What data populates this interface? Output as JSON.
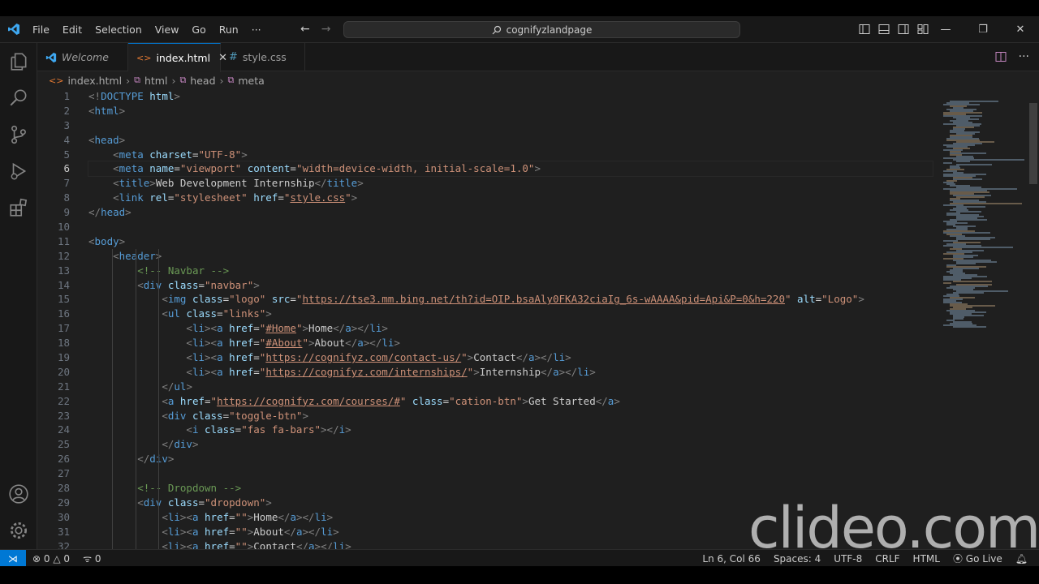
{
  "titlebar": {
    "menu": [
      "File",
      "Edit",
      "Selection",
      "View",
      "Go",
      "Run",
      "···"
    ],
    "search_text": "cognifyzlandpage",
    "window_controls": [
      "minimize-icon",
      "restore-icon",
      "close-icon"
    ]
  },
  "tabs": [
    {
      "label": "Welcome",
      "icon": "vscode-icon"
    },
    {
      "label": "index.html",
      "icon": "html-icon",
      "active": true
    },
    {
      "label": "style.css",
      "icon": "css-hash-icon"
    }
  ],
  "breadcrumb": [
    "index.html",
    "html",
    "head",
    "meta"
  ],
  "editor": {
    "line_numbers": [
      "1",
      "2",
      "3",
      "4",
      "5",
      "6",
      "7",
      "8",
      "9",
      "10",
      "11",
      "12",
      "13",
      "14",
      "15",
      "16",
      "17",
      "18",
      "19",
      "20",
      "21",
      "22",
      "23",
      "24",
      "25",
      "26",
      "27",
      "28",
      "29",
      "30",
      "31",
      "32"
    ],
    "active_line": "6",
    "lines": [
      [
        [
          "p",
          "<!"
        ],
        [
          "t",
          "DOCTYPE"
        ],
        [
          "x",
          " "
        ],
        [
          "a",
          "html"
        ],
        [
          "p",
          ">"
        ]
      ],
      [
        [
          "p",
          "<"
        ],
        [
          "t",
          "html"
        ],
        [
          "p",
          ">"
        ]
      ],
      [],
      [
        [
          "p",
          "<"
        ],
        [
          "t",
          "head"
        ],
        [
          "p",
          ">"
        ]
      ],
      [
        [
          "x",
          "    "
        ],
        [
          "p",
          "<"
        ],
        [
          "t",
          "meta"
        ],
        [
          "x",
          " "
        ],
        [
          "a",
          "charset"
        ],
        [
          "x",
          "="
        ],
        [
          "s",
          "\"UTF-8\""
        ],
        [
          "p",
          ">"
        ]
      ],
      [
        [
          "x",
          "    "
        ],
        [
          "p",
          "<"
        ],
        [
          "t",
          "meta"
        ],
        [
          "x",
          " "
        ],
        [
          "a",
          "name"
        ],
        [
          "x",
          "="
        ],
        [
          "s",
          "\"viewport\""
        ],
        [
          "x",
          " "
        ],
        [
          "a",
          "content"
        ],
        [
          "x",
          "="
        ],
        [
          "s",
          "\"width=device-width, initial-scale=1.0\""
        ],
        [
          "p",
          ">"
        ]
      ],
      [
        [
          "x",
          "    "
        ],
        [
          "p",
          "<"
        ],
        [
          "t",
          "title"
        ],
        [
          "p",
          ">"
        ],
        [
          "x",
          "Web Development Internship"
        ],
        [
          "p",
          "</"
        ],
        [
          "t",
          "title"
        ],
        [
          "p",
          ">"
        ]
      ],
      [
        [
          "x",
          "    "
        ],
        [
          "p",
          "<"
        ],
        [
          "t",
          "link"
        ],
        [
          "x",
          " "
        ],
        [
          "a",
          "rel"
        ],
        [
          "x",
          "="
        ],
        [
          "s",
          "\"stylesheet\""
        ],
        [
          "x",
          " "
        ],
        [
          "a",
          "href"
        ],
        [
          "x",
          "="
        ],
        [
          "s",
          "\""
        ],
        [
          "u",
          "style.css"
        ],
        [
          "s",
          "\""
        ],
        [
          "p",
          ">"
        ]
      ],
      [
        [
          "p",
          "</"
        ],
        [
          "t",
          "head"
        ],
        [
          "p",
          ">"
        ]
      ],
      [],
      [
        [
          "p",
          "<"
        ],
        [
          "t",
          "body"
        ],
        [
          "p",
          ">"
        ]
      ],
      [
        [
          "x",
          "    "
        ],
        [
          "p",
          "<"
        ],
        [
          "t",
          "header"
        ],
        [
          "p",
          ">"
        ]
      ],
      [
        [
          "x",
          "        "
        ],
        [
          "c",
          "<!-- Navbar -->"
        ]
      ],
      [
        [
          "x",
          "        "
        ],
        [
          "p",
          "<"
        ],
        [
          "t",
          "div"
        ],
        [
          "x",
          " "
        ],
        [
          "a",
          "class"
        ],
        [
          "x",
          "="
        ],
        [
          "s",
          "\"navbar\""
        ],
        [
          "p",
          ">"
        ]
      ],
      [
        [
          "x",
          "            "
        ],
        [
          "p",
          "<"
        ],
        [
          "t",
          "img"
        ],
        [
          "x",
          " "
        ],
        [
          "a",
          "class"
        ],
        [
          "x",
          "="
        ],
        [
          "s",
          "\"logo\""
        ],
        [
          "x",
          " "
        ],
        [
          "a",
          "src"
        ],
        [
          "x",
          "="
        ],
        [
          "s",
          "\""
        ],
        [
          "u",
          "https://tse3.mm.bing.net/th?id=OIP.bsaAly0FKA32ciaIg_6s-wAAAA&pid=Api&P=0&h=220"
        ],
        [
          "s",
          "\""
        ],
        [
          "x",
          " "
        ],
        [
          "a",
          "alt"
        ],
        [
          "x",
          "="
        ],
        [
          "s",
          "\"Logo\""
        ],
        [
          "p",
          ">"
        ]
      ],
      [
        [
          "x",
          "            "
        ],
        [
          "p",
          "<"
        ],
        [
          "t",
          "ul"
        ],
        [
          "x",
          " "
        ],
        [
          "a",
          "class"
        ],
        [
          "x",
          "="
        ],
        [
          "s",
          "\"links\""
        ],
        [
          "p",
          ">"
        ]
      ],
      [
        [
          "x",
          "                "
        ],
        [
          "p",
          "<"
        ],
        [
          "t",
          "li"
        ],
        [
          "p",
          "><"
        ],
        [
          "t",
          "a"
        ],
        [
          "x",
          " "
        ],
        [
          "a",
          "href"
        ],
        [
          "x",
          "="
        ],
        [
          "s",
          "\""
        ],
        [
          "u",
          "#Home"
        ],
        [
          "s",
          "\""
        ],
        [
          "p",
          ">"
        ],
        [
          "x",
          "Home"
        ],
        [
          "p",
          "</"
        ],
        [
          "t",
          "a"
        ],
        [
          "p",
          "></"
        ],
        [
          "t",
          "li"
        ],
        [
          "p",
          ">"
        ]
      ],
      [
        [
          "x",
          "                "
        ],
        [
          "p",
          "<"
        ],
        [
          "t",
          "li"
        ],
        [
          "p",
          "><"
        ],
        [
          "t",
          "a"
        ],
        [
          "x",
          " "
        ],
        [
          "a",
          "href"
        ],
        [
          "x",
          "="
        ],
        [
          "s",
          "\""
        ],
        [
          "u",
          "#About"
        ],
        [
          "s",
          "\""
        ],
        [
          "p",
          ">"
        ],
        [
          "x",
          "About"
        ],
        [
          "p",
          "</"
        ],
        [
          "t",
          "a"
        ],
        [
          "p",
          "></"
        ],
        [
          "t",
          "li"
        ],
        [
          "p",
          ">"
        ]
      ],
      [
        [
          "x",
          "                "
        ],
        [
          "p",
          "<"
        ],
        [
          "t",
          "li"
        ],
        [
          "p",
          "><"
        ],
        [
          "t",
          "a"
        ],
        [
          "x",
          " "
        ],
        [
          "a",
          "href"
        ],
        [
          "x",
          "="
        ],
        [
          "s",
          "\""
        ],
        [
          "u",
          "https://cognifyz.com/contact-us/"
        ],
        [
          "s",
          "\""
        ],
        [
          "p",
          ">"
        ],
        [
          "x",
          "Contact"
        ],
        [
          "p",
          "</"
        ],
        [
          "t",
          "a"
        ],
        [
          "p",
          "></"
        ],
        [
          "t",
          "li"
        ],
        [
          "p",
          ">"
        ]
      ],
      [
        [
          "x",
          "                "
        ],
        [
          "p",
          "<"
        ],
        [
          "t",
          "li"
        ],
        [
          "p",
          "><"
        ],
        [
          "t",
          "a"
        ],
        [
          "x",
          " "
        ],
        [
          "a",
          "href"
        ],
        [
          "x",
          "="
        ],
        [
          "s",
          "\""
        ],
        [
          "u",
          "https://cognifyz.com/internships/"
        ],
        [
          "s",
          "\""
        ],
        [
          "p",
          ">"
        ],
        [
          "x",
          "Internship"
        ],
        [
          "p",
          "</"
        ],
        [
          "t",
          "a"
        ],
        [
          "p",
          "></"
        ],
        [
          "t",
          "li"
        ],
        [
          "p",
          ">"
        ]
      ],
      [
        [
          "x",
          "            "
        ],
        [
          "p",
          "</"
        ],
        [
          "t",
          "ul"
        ],
        [
          "p",
          ">"
        ]
      ],
      [
        [
          "x",
          "            "
        ],
        [
          "p",
          "<"
        ],
        [
          "t",
          "a"
        ],
        [
          "x",
          " "
        ],
        [
          "a",
          "href"
        ],
        [
          "x",
          "="
        ],
        [
          "s",
          "\""
        ],
        [
          "u",
          "https://cognifyz.com/courses/#"
        ],
        [
          "s",
          "\""
        ],
        [
          "x",
          " "
        ],
        [
          "a",
          "class"
        ],
        [
          "x",
          "="
        ],
        [
          "s",
          "\"cation-btn\""
        ],
        [
          "p",
          ">"
        ],
        [
          "x",
          "Get Started"
        ],
        [
          "p",
          "</"
        ],
        [
          "t",
          "a"
        ],
        [
          "p",
          ">"
        ]
      ],
      [
        [
          "x",
          "            "
        ],
        [
          "p",
          "<"
        ],
        [
          "t",
          "div"
        ],
        [
          "x",
          " "
        ],
        [
          "a",
          "class"
        ],
        [
          "x",
          "="
        ],
        [
          "s",
          "\"toggle-btn\""
        ],
        [
          "p",
          ">"
        ]
      ],
      [
        [
          "x",
          "                "
        ],
        [
          "p",
          "<"
        ],
        [
          "t",
          "i"
        ],
        [
          "x",
          " "
        ],
        [
          "a",
          "class"
        ],
        [
          "x",
          "="
        ],
        [
          "s",
          "\"fas fa-bars\""
        ],
        [
          "p",
          "></"
        ],
        [
          "t",
          "i"
        ],
        [
          "p",
          ">"
        ]
      ],
      [
        [
          "x",
          "            "
        ],
        [
          "p",
          "</"
        ],
        [
          "t",
          "div"
        ],
        [
          "p",
          ">"
        ]
      ],
      [
        [
          "x",
          "        "
        ],
        [
          "p",
          "</"
        ],
        [
          "t",
          "div"
        ],
        [
          "p",
          ">"
        ]
      ],
      [],
      [
        [
          "x",
          "        "
        ],
        [
          "c",
          "<!-- Dropdown -->"
        ]
      ],
      [
        [
          "x",
          "        "
        ],
        [
          "p",
          "<"
        ],
        [
          "t",
          "div"
        ],
        [
          "x",
          " "
        ],
        [
          "a",
          "class"
        ],
        [
          "x",
          "="
        ],
        [
          "s",
          "\"dropdown\""
        ],
        [
          "p",
          ">"
        ]
      ],
      [
        [
          "x",
          "            "
        ],
        [
          "p",
          "<"
        ],
        [
          "t",
          "li"
        ],
        [
          "p",
          "><"
        ],
        [
          "t",
          "a"
        ],
        [
          "x",
          " "
        ],
        [
          "a",
          "href"
        ],
        [
          "x",
          "="
        ],
        [
          "s",
          "\"\""
        ],
        [
          "p",
          ">"
        ],
        [
          "x",
          "Home"
        ],
        [
          "p",
          "</"
        ],
        [
          "t",
          "a"
        ],
        [
          "p",
          "></"
        ],
        [
          "t",
          "li"
        ],
        [
          "p",
          ">"
        ]
      ],
      [
        [
          "x",
          "            "
        ],
        [
          "p",
          "<"
        ],
        [
          "t",
          "li"
        ],
        [
          "p",
          "><"
        ],
        [
          "t",
          "a"
        ],
        [
          "x",
          " "
        ],
        [
          "a",
          "href"
        ],
        [
          "x",
          "="
        ],
        [
          "s",
          "\"\""
        ],
        [
          "p",
          ">"
        ],
        [
          "x",
          "About"
        ],
        [
          "p",
          "</"
        ],
        [
          "t",
          "a"
        ],
        [
          "p",
          "></"
        ],
        [
          "t",
          "li"
        ],
        [
          "p",
          ">"
        ]
      ],
      [
        [
          "x",
          "            "
        ],
        [
          "p",
          "<"
        ],
        [
          "t",
          "li"
        ],
        [
          "p",
          "><"
        ],
        [
          "t",
          "a"
        ],
        [
          "x",
          " "
        ],
        [
          "a",
          "href"
        ],
        [
          "x",
          "="
        ],
        [
          "s",
          "\"\""
        ],
        [
          "p",
          ">"
        ],
        [
          "x",
          "Contact"
        ],
        [
          "p",
          "</"
        ],
        [
          "t",
          "a"
        ],
        [
          "p",
          "></"
        ],
        [
          "t",
          "li"
        ],
        [
          "p",
          ">"
        ]
      ]
    ]
  },
  "statusbar": {
    "errors": "0",
    "warnings": "0",
    "ports": "0",
    "position": "Ln 6, Col 66",
    "spaces": "Spaces: 4",
    "encoding": "UTF-8",
    "eol": "CRLF",
    "language": "HTML",
    "live": "Go Live"
  },
  "watermark": "clideo.com",
  "colors": {
    "accent": "#0078d4",
    "tag": "#569cd6",
    "attr": "#9cdcfe",
    "string": "#ce9178",
    "comment": "#6a9955"
  }
}
